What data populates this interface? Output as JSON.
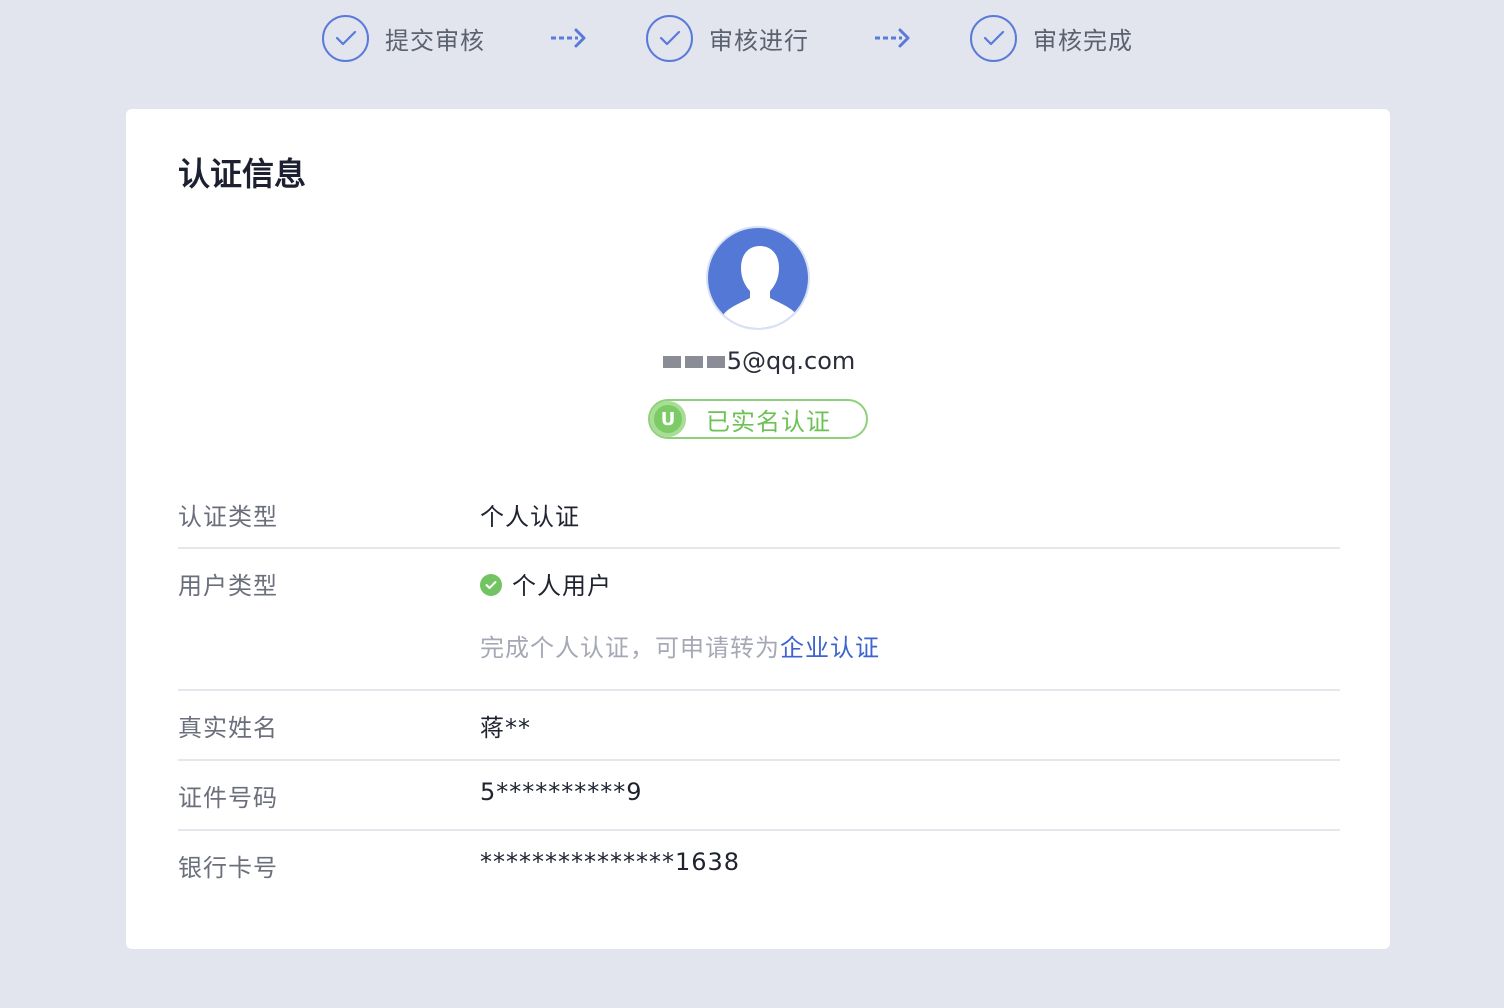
{
  "steps": [
    {
      "label": "提交审核"
    },
    {
      "label": "审核进行"
    },
    {
      "label": "审核完成"
    }
  ],
  "card": {
    "title": "认证信息",
    "email_visible_suffix": "5@qq.com",
    "badge_letter": "U",
    "badge_text": "已实名认证"
  },
  "rows": {
    "auth_type": {
      "label": "认证类型",
      "value": "个人认证"
    },
    "user_type": {
      "label": "用户类型",
      "value": "个人用户",
      "hint_prefix": "完成个人认证，可申请转为",
      "hint_link": "企业认证"
    },
    "real_name": {
      "label": "真实姓名",
      "value": "蒋**"
    },
    "id_number": {
      "label": "证件号码",
      "value": "5**********9"
    },
    "bank_card": {
      "label": "银行卡号",
      "value": "***************1638"
    }
  },
  "colors": {
    "accent": "#5a7ad9",
    "success": "#72c462",
    "link": "#3d63d1",
    "background": "#e2e4ee"
  }
}
